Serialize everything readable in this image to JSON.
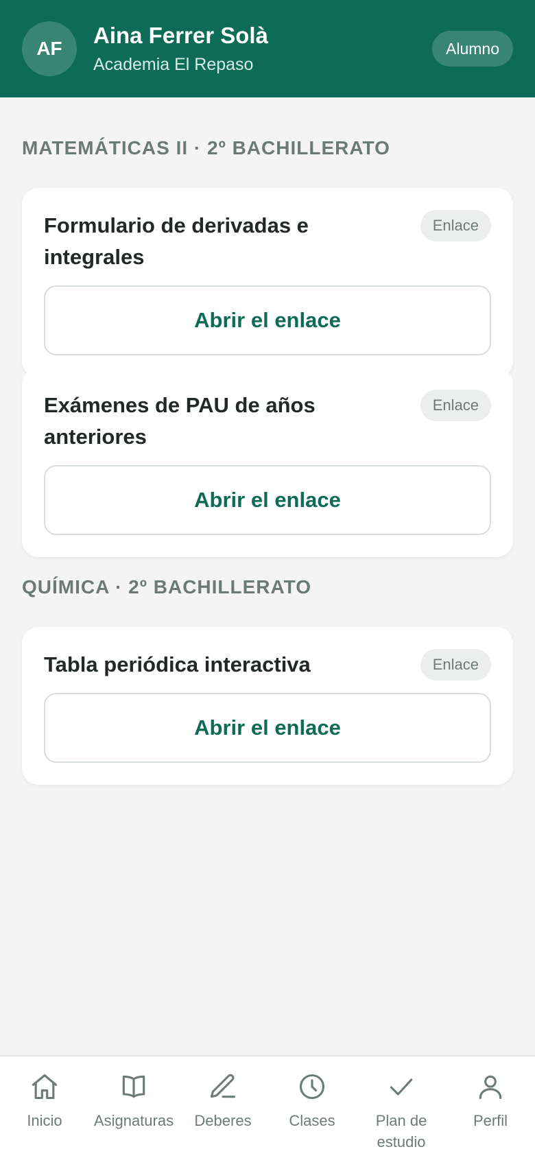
{
  "header": {
    "avatar_initials": "AF",
    "user_name": "Aina Ferrer Solà",
    "org_name": "Academia El Repaso",
    "role": "Alumno"
  },
  "sections": [
    {
      "title": "MATEMÁTICAS II · 2º BACHILLERATO",
      "cards": [
        {
          "title": "Formulario de derivadas e integrales",
          "badge": "Enlace",
          "button": "Abrir el enlace"
        },
        {
          "title": "Exámenes de PAU de años anteriores",
          "badge": "Enlace",
          "button": "Abrir el enlace"
        }
      ]
    },
    {
      "title": "QUÍMICA · 2º BACHILLERATO",
      "cards": [
        {
          "title": "Tabla periódica interactiva",
          "badge": "Enlace",
          "button": "Abrir el enlace"
        }
      ]
    }
  ],
  "nav": [
    {
      "label": "Inicio",
      "icon": "home-icon"
    },
    {
      "label": "Asignaturas",
      "icon": "book-icon"
    },
    {
      "label": "Deberes",
      "icon": "pencil-icon"
    },
    {
      "label": "Clases",
      "icon": "clock-icon"
    },
    {
      "label": "Plan de estudio",
      "icon": "check-icon"
    },
    {
      "label": "Perfil",
      "icon": "user-icon"
    }
  ],
  "colors": {
    "brand": "#0d6b58",
    "background": "#f3f4f3",
    "muted_text": "#6e7a77"
  }
}
